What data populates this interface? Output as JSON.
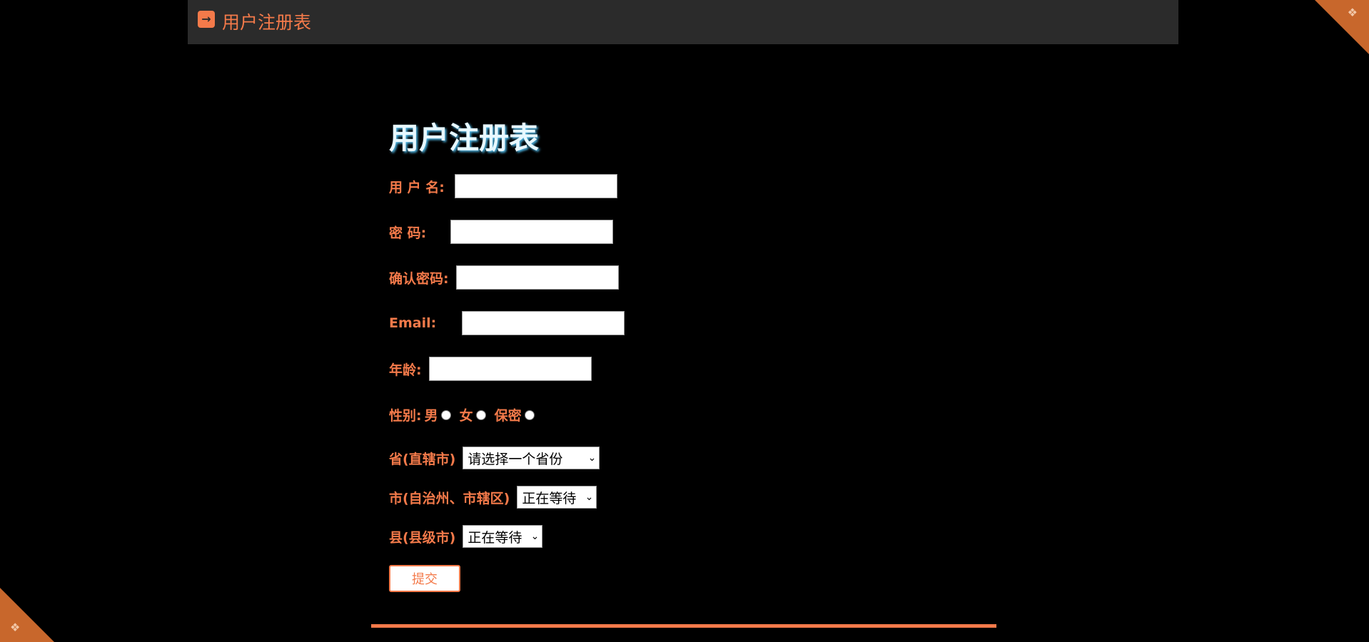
{
  "header": {
    "title": "用户注册表"
  },
  "form": {
    "heading": "用户注册表",
    "username_label": "用 户 名:",
    "password_label": "密 码:",
    "confirm_label": "确认密码:",
    "email_label": "Email:",
    "age_label": "年龄:",
    "gender_label": "性别:",
    "gender_options": [
      "男",
      "女",
      "保密"
    ],
    "province_label": "省(直辖市)",
    "province_selected": "请选择一个省份",
    "city_label": "市(自治州、市辖区)",
    "city_selected": "正在等待",
    "county_label": "县(县级市)",
    "county_selected": "正在等待",
    "submit_label": "提交"
  },
  "colors": {
    "accent": "#f47a4a",
    "background": "#000000",
    "topbar": "#2b2b2b",
    "corner": "#c8672c",
    "heading": "#e8f8ff"
  },
  "icons": {
    "header": "arrow-right-icon",
    "corners": "menu-grid-icon"
  }
}
